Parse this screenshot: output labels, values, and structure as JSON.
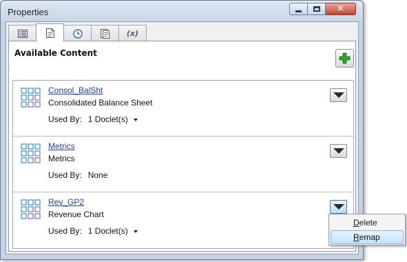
{
  "window": {
    "title": "Properties",
    "buttons": {
      "minimize_icon": "minimize-icon",
      "maximize_icon": "maximize-icon",
      "close_icon": "close-icon"
    }
  },
  "tabs": [
    {
      "icon": "list-icon",
      "active": false
    },
    {
      "icon": "document-icon",
      "active": true
    },
    {
      "icon": "clock-icon",
      "active": false
    },
    {
      "icon": "clipboard-icon",
      "active": false
    },
    {
      "icon": "function-icon",
      "label": "(x)",
      "active": false
    }
  ],
  "panel": {
    "heading": "Available Content",
    "add_button_icon": "add-plus-icon"
  },
  "items": [
    {
      "name": "Consol_BalSht",
      "description": "Consolidated Balance Sheet",
      "used_by_label": "Used By:",
      "used_by_value": "1 Doclet(s)",
      "has_dropdown": true
    },
    {
      "name": "Metrics",
      "description": "Metrics",
      "used_by_label": "Used By:",
      "used_by_value": "None",
      "has_dropdown": false
    },
    {
      "name": "Rev_GP2",
      "description": "Revenue Chart",
      "used_by_label": "Used By:",
      "used_by_value": "1 Doclet(s)",
      "has_dropdown": true
    }
  ],
  "context_menu": {
    "items": [
      {
        "label_first": "D",
        "label_rest": "elete",
        "highlighted": false
      },
      {
        "label_first": "R",
        "label_rest": "emap",
        "highlighted": true
      }
    ]
  },
  "colors": {
    "link": "#1a3fb8",
    "add_green": "#2aa52a",
    "grid_blue": "#2f8fcc",
    "grid_purple": "#8a6bb0"
  }
}
